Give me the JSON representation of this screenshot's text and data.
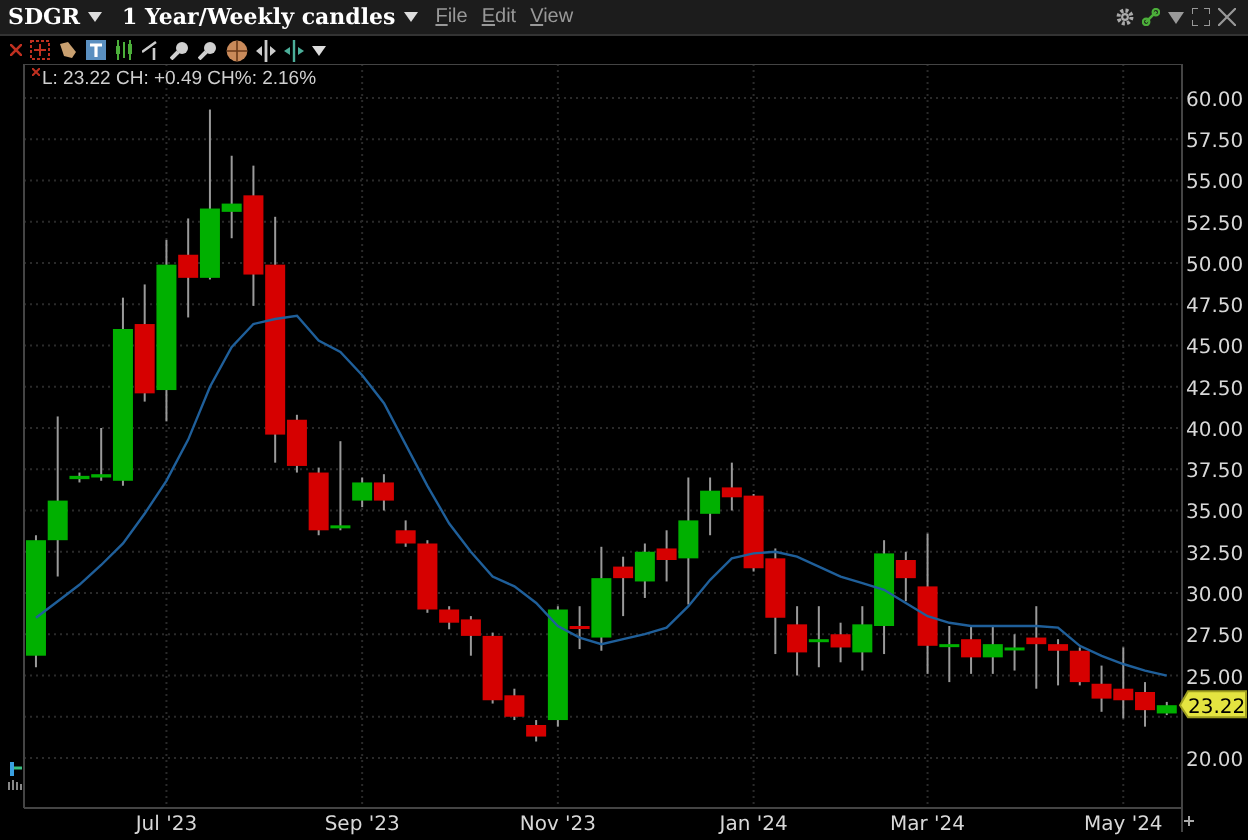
{
  "header": {
    "symbol": "SDGR",
    "period": "1 Year/Weekly candles",
    "menu": [
      "File",
      "Edit",
      "View"
    ]
  },
  "chart": {
    "legend": "L: 23.22 CH: +0.49 CH%: 2.16%",
    "last_price": "23.22",
    "chart_data": {
      "type": "candlestick",
      "grid": true,
      "ylim": [
        16.97,
        62.06
      ],
      "categories": [
        null,
        null,
        null,
        null,
        null,
        null,
        "Jul '23",
        null,
        null,
        null,
        null,
        null,
        null,
        null,
        null,
        "Sep '23",
        null,
        null,
        null,
        null,
        null,
        null,
        null,
        null,
        "Nov '23",
        null,
        null,
        null,
        null,
        null,
        null,
        null,
        null,
        "Jan '24",
        null,
        null,
        null,
        null,
        null,
        null,
        null,
        "Mar '24",
        null,
        null,
        null,
        null,
        null,
        null,
        null,
        null,
        "May '24",
        null,
        null
      ],
      "yticks": [
        {
          "value": 60,
          "label": "60.00"
        },
        {
          "value": 57.5,
          "label": "57.50"
        },
        {
          "value": 55,
          "label": "55.00"
        },
        {
          "value": 52.5,
          "label": "52.50"
        },
        {
          "value": 50,
          "label": "50.00"
        },
        {
          "value": 47.5,
          "label": "47.50"
        },
        {
          "value": 45,
          "label": "45.00"
        },
        {
          "value": 42.5,
          "label": "42.50"
        },
        {
          "value": 40,
          "label": "40.00"
        },
        {
          "value": 37.5,
          "label": "37.50"
        },
        {
          "value": 35,
          "label": "35.00"
        },
        {
          "value": 32.5,
          "label": "32.50"
        },
        {
          "value": 30,
          "label": "30.00"
        },
        {
          "value": 27.5,
          "label": "27.50"
        },
        {
          "value": 25,
          "label": "25.00"
        },
        {
          "value": 20,
          "label": "20.00"
        }
      ],
      "ohlc": [
        [
          26.2,
          33.5,
          25.5,
          33.2
        ],
        [
          33.2,
          40.7,
          31.0,
          35.6
        ],
        [
          36.9,
          37.3,
          36.7,
          37.1
        ],
        [
          37.0,
          40.0,
          36.8,
          37.2
        ],
        [
          36.8,
          47.9,
          36.5,
          46.0
        ],
        [
          46.3,
          48.7,
          41.6,
          42.1
        ],
        [
          42.3,
          51.4,
          40.4,
          49.9
        ],
        [
          50.5,
          52.7,
          46.7,
          49.1
        ],
        [
          49.1,
          59.3,
          49.0,
          53.3
        ],
        [
          53.1,
          56.5,
          51.5,
          53.6
        ],
        [
          54.1,
          55.9,
          47.4,
          49.3
        ],
        [
          49.9,
          52.8,
          37.9,
          39.6
        ],
        [
          40.5,
          40.8,
          37.3,
          37.7
        ],
        [
          37.3,
          37.6,
          33.5,
          33.8
        ],
        [
          34.0,
          39.2,
          33.8,
          34.1
        ],
        [
          35.6,
          37.0,
          35.2,
          36.7
        ],
        [
          36.7,
          37.2,
          35.0,
          35.6
        ],
        [
          33.8,
          34.4,
          32.8,
          33.0
        ],
        [
          33.0,
          33.2,
          28.8,
          29.0
        ],
        [
          29.0,
          29.2,
          27.8,
          28.2
        ],
        [
          28.4,
          28.6,
          26.2,
          27.4
        ],
        [
          27.4,
          27.6,
          23.3,
          23.5
        ],
        [
          23.8,
          24.2,
          22.3,
          22.5
        ],
        [
          22.0,
          22.3,
          21.0,
          21.3
        ],
        [
          22.3,
          29.2,
          21.9,
          29.0
        ],
        [
          28.0,
          29.2,
          26.6,
          27.9
        ],
        [
          27.3,
          32.8,
          26.5,
          30.9
        ],
        [
          31.6,
          32.2,
          28.6,
          30.9
        ],
        [
          30.7,
          33.0,
          29.7,
          32.5
        ],
        [
          32.7,
          33.8,
          30.7,
          32.0
        ],
        [
          32.1,
          37.0,
          29.3,
          34.4
        ],
        [
          34.8,
          37.0,
          33.5,
          36.2
        ],
        [
          36.4,
          37.9,
          35.0,
          35.8
        ],
        [
          35.9,
          36.0,
          31.3,
          31.5
        ],
        [
          32.1,
          32.7,
          26.3,
          28.5
        ],
        [
          28.1,
          29.2,
          25.0,
          26.4
        ],
        [
          27.1,
          29.2,
          25.5,
          27.2
        ],
        [
          27.5,
          28.2,
          25.8,
          26.7
        ],
        [
          26.4,
          29.2,
          25.3,
          28.1
        ],
        [
          28.0,
          33.2,
          26.3,
          32.4
        ],
        [
          32.0,
          32.5,
          29.5,
          30.9
        ],
        [
          30.4,
          33.6,
          25.1,
          26.8
        ],
        [
          26.8,
          28.0,
          24.6,
          26.9
        ],
        [
          27.2,
          28.0,
          25.1,
          26.1
        ],
        [
          26.1,
          28.0,
          25.1,
          26.9
        ],
        [
          26.6,
          27.5,
          25.3,
          26.7
        ],
        [
          27.3,
          29.2,
          24.2,
          26.9
        ],
        [
          26.9,
          27.2,
          24.4,
          26.5
        ],
        [
          26.5,
          26.7,
          24.4,
          24.6
        ],
        [
          24.5,
          25.6,
          22.8,
          23.6
        ],
        [
          24.2,
          26.7,
          22.4,
          23.5
        ],
        [
          24.0,
          24.6,
          21.9,
          22.9
        ],
        [
          22.7,
          23.4,
          22.6,
          23.2
        ]
      ],
      "series": [
        {
          "type": "line",
          "color": "#1f5f9a",
          "values": [
            28.5,
            29.5,
            30.5,
            31.7,
            33.0,
            34.8,
            36.8,
            39.3,
            42.5,
            44.9,
            46.3,
            46.6,
            46.8,
            45.3,
            44.6,
            43.2,
            41.5,
            39.0,
            36.5,
            34.2,
            32.5,
            31.0,
            30.4,
            29.4,
            28.0,
            27.3,
            26.9,
            27.2,
            27.5,
            27.9,
            29.2,
            30.8,
            32.1,
            32.4,
            32.5,
            32.2,
            31.6,
            31.0,
            30.6,
            30.2,
            29.4,
            28.6,
            28.2,
            28.0,
            28.0,
            28.0,
            28.0,
            27.9,
            26.8,
            26.2,
            25.7,
            25.3,
            25.0
          ]
        }
      ]
    }
  }
}
